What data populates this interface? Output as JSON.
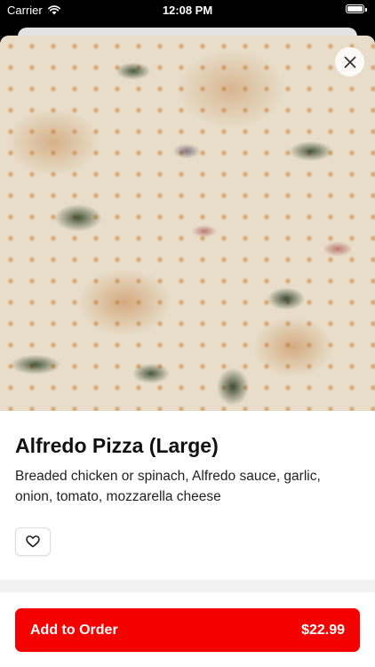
{
  "status_bar": {
    "carrier": "Carrier",
    "time": "12:08 PM"
  },
  "item": {
    "name": "Alfredo Pizza (Large)",
    "description": "Breaded chicken or spinach, Alfredo sauce, garlic, onion, tomato, mozzarella cheese",
    "price": "$22.99"
  },
  "actions": {
    "add_to_order_label": "Add to Order"
  },
  "colors": {
    "accent": "#f40000",
    "divider": "#f2f2f2"
  },
  "icons": {
    "close": "close-icon",
    "favorite": "heart-icon",
    "wifi": "wifi-icon",
    "battery": "battery-icon"
  }
}
